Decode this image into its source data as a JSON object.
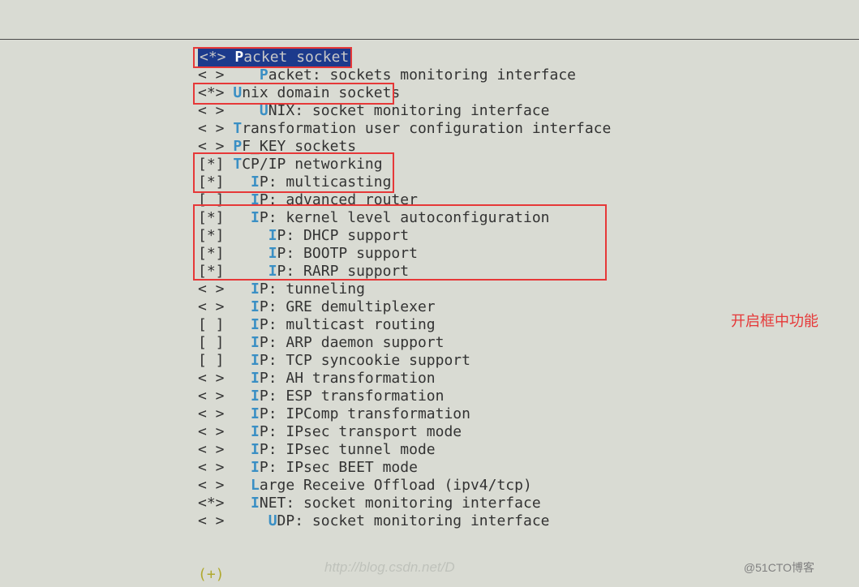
{
  "items": [
    {
      "bracket": "<*>",
      "indent": "",
      "hotkey": "P",
      "text": "acket socket",
      "selected": true
    },
    {
      "bracket": "< >",
      "indent": "   ",
      "hotkey": "P",
      "text": "acket: sockets monitoring interface"
    },
    {
      "bracket": "<*>",
      "indent": "",
      "hotkey": "U",
      "text": "nix domain sockets"
    },
    {
      "bracket": "< >",
      "indent": "   ",
      "hotkey": "U",
      "text": "NIX: socket monitoring interface"
    },
    {
      "bracket": "< >",
      "indent": "",
      "hotkey": "T",
      "text": "ransformation user configuration interface"
    },
    {
      "bracket": "< >",
      "indent": "",
      "hotkey": "P",
      "text": "F_KEY sockets"
    },
    {
      "bracket": "[*]",
      "indent": "",
      "hotkey": "T",
      "text": "CP/IP networking"
    },
    {
      "bracket": "[*]",
      "indent": "  ",
      "hotkey": "I",
      "text": "P: multicasting"
    },
    {
      "bracket": "[ ]",
      "indent": "  ",
      "hotkey": "I",
      "text": "P: advanced router"
    },
    {
      "bracket": "[*]",
      "indent": "  ",
      "hotkey": "I",
      "text": "P: kernel level autoconfiguration"
    },
    {
      "bracket": "[*]",
      "indent": "    ",
      "hotkey": "I",
      "text": "P: DHCP support"
    },
    {
      "bracket": "[*]",
      "indent": "    ",
      "hotkey": "I",
      "text": "P: BOOTP support"
    },
    {
      "bracket": "[*]",
      "indent": "    ",
      "hotkey": "I",
      "text": "P: RARP support"
    },
    {
      "bracket": "< >",
      "indent": "  ",
      "hotkey": "I",
      "text": "P: tunneling"
    },
    {
      "bracket": "< >",
      "indent": "  ",
      "hotkey": "I",
      "text": "P: GRE demultiplexer"
    },
    {
      "bracket": "[ ]",
      "indent": "  ",
      "hotkey": "I",
      "text": "P: multicast routing"
    },
    {
      "bracket": "[ ]",
      "indent": "  ",
      "hotkey": "I",
      "text": "P: ARP daemon support"
    },
    {
      "bracket": "[ ]",
      "indent": "  ",
      "hotkey": "I",
      "text": "P: TCP syncookie support"
    },
    {
      "bracket": "< >",
      "indent": "  ",
      "hotkey": "I",
      "text": "P: AH transformation"
    },
    {
      "bracket": "< >",
      "indent": "  ",
      "hotkey": "I",
      "text": "P: ESP transformation"
    },
    {
      "bracket": "< >",
      "indent": "  ",
      "hotkey": "I",
      "text": "P: IPComp transformation"
    },
    {
      "bracket": "< >",
      "indent": "  ",
      "hotkey": "I",
      "text": "P: IPsec transport mode"
    },
    {
      "bracket": "< >",
      "indent": "  ",
      "hotkey": "I",
      "text": "P: IPsec tunnel mode"
    },
    {
      "bracket": "< >",
      "indent": "  ",
      "hotkey": "I",
      "text": "P: IPsec BEET mode"
    },
    {
      "bracket": "< >",
      "indent": "  ",
      "hotkey": "L",
      "text": "arge Receive Offload (ipv4/tcp)"
    },
    {
      "bracket": "<*>",
      "indent": "  ",
      "hotkey": "I",
      "text": "NET: socket monitoring interface"
    },
    {
      "bracket": "< >",
      "indent": "    ",
      "hotkey": "U",
      "text": "DP: socket monitoring interface"
    }
  ],
  "annotation": "开启框中功能",
  "watermark_light": "http://blog.csdn.net/D",
  "watermark_dark": "@51CTO博客",
  "last_line": "(+)"
}
